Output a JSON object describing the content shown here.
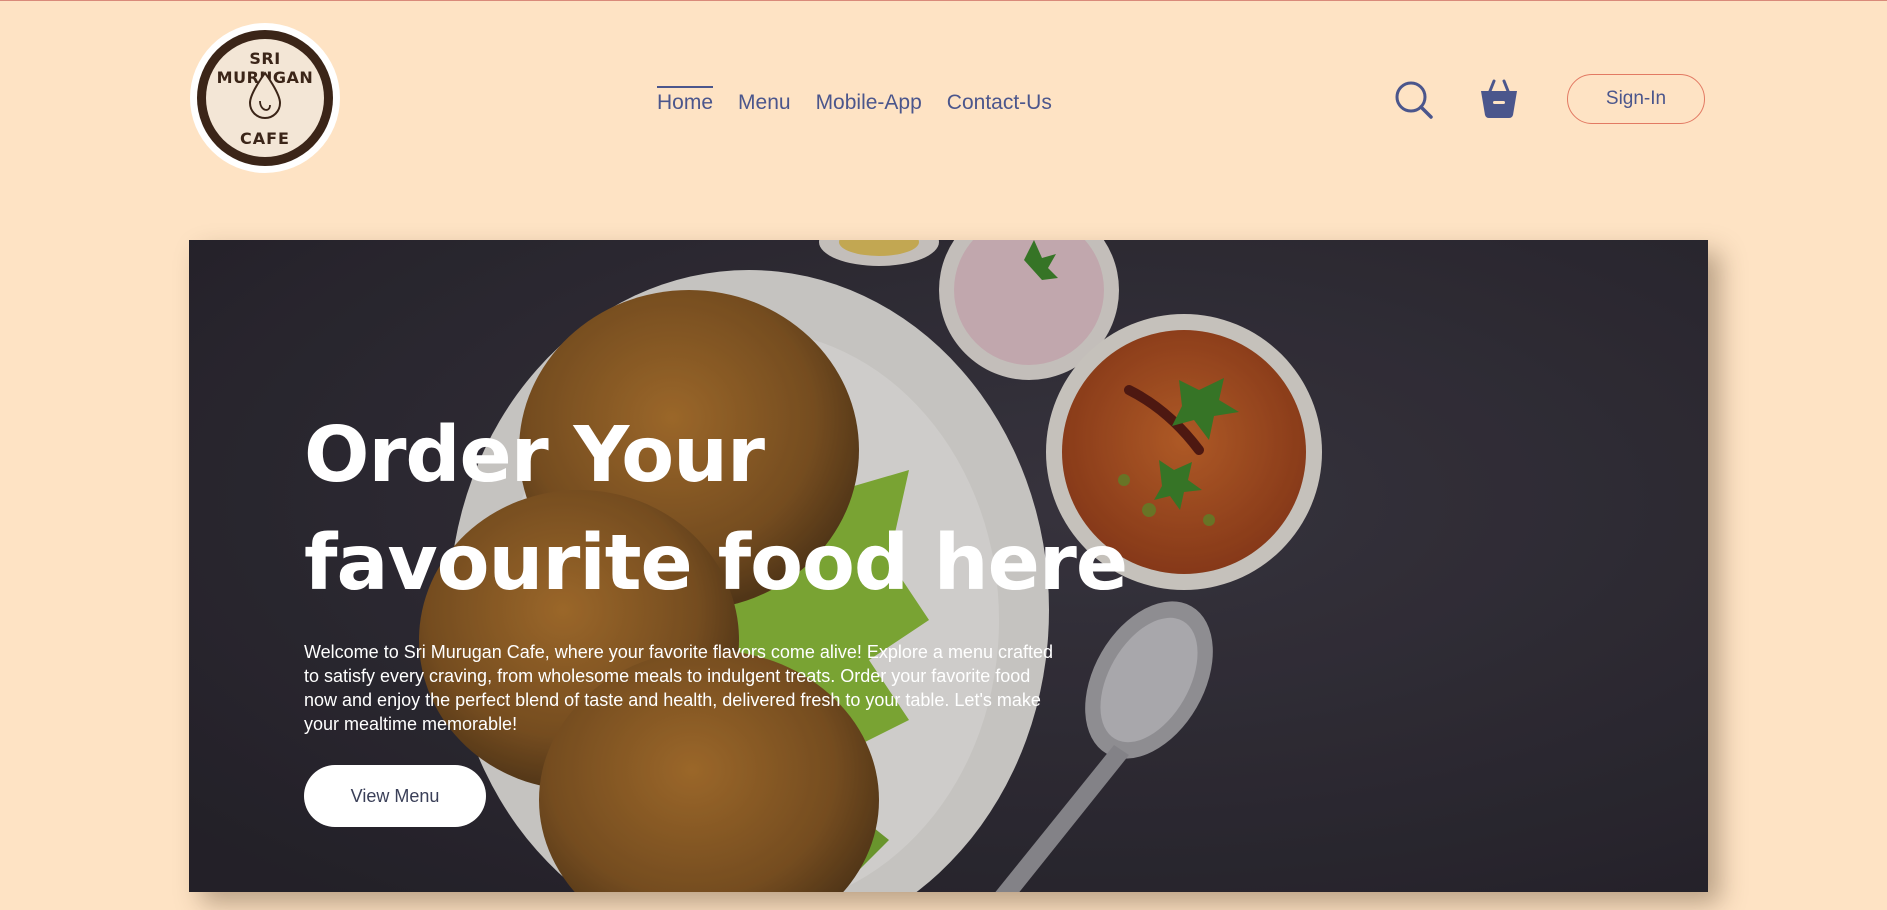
{
  "brand": {
    "logo_top": "SRI MURUGAN",
    "logo_bottom": "CAFE"
  },
  "nav": {
    "items": [
      {
        "label": "Home",
        "active": true
      },
      {
        "label": "Menu",
        "active": false
      },
      {
        "label": "Mobile-App",
        "active": false
      },
      {
        "label": "Contact-Us",
        "active": false
      }
    ]
  },
  "header": {
    "search_icon": "search-icon",
    "basket_icon": "basket-icon",
    "signin_label": "Sign-In"
  },
  "hero": {
    "title_line1": "Order Your",
    "title_line2": "favourite food here",
    "description": "Welcome to Sri Murugan Cafe, where your favorite flavors come alive! Explore a menu crafted to satisfy every craving, from wholesome meals to indulgent treats. Order your favorite food now and enjoy the perfect blend of taste and health, delivered fresh to your table. Let's make your mealtime memorable!",
    "button_label": "View Menu"
  },
  "colors": {
    "background": "#fee3c4",
    "nav_text": "#4b568c",
    "signin_border": "#e27a63",
    "hero_bg": "#2f2c36"
  }
}
